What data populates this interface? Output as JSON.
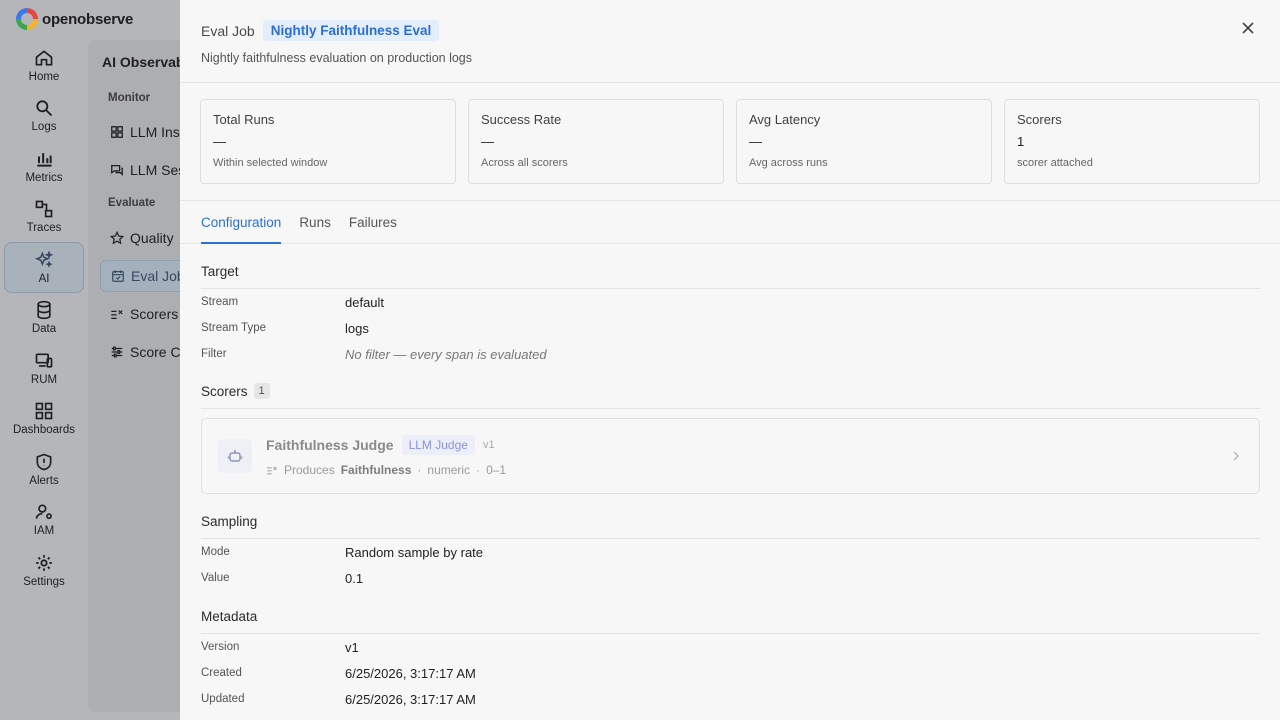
{
  "app": {
    "brand": "openobserve"
  },
  "nav": [
    {
      "label": "Home",
      "icon": "home-icon"
    },
    {
      "label": "Logs",
      "icon": "search-icon"
    },
    {
      "label": "Metrics",
      "icon": "bar-chart-icon"
    },
    {
      "label": "Traces",
      "icon": "traces-icon"
    },
    {
      "label": "AI",
      "icon": "sparkles-icon",
      "active": true
    },
    {
      "label": "Data",
      "icon": "database-icon"
    },
    {
      "label": "RUM",
      "icon": "devices-icon"
    },
    {
      "label": "Dashboards",
      "icon": "dashboard-grid-icon"
    },
    {
      "label": "Alerts",
      "icon": "shield-alert-icon"
    },
    {
      "label": "IAM",
      "icon": "user-gear-icon"
    },
    {
      "label": "Settings",
      "icon": "gear-icon"
    }
  ],
  "subpanel": {
    "title": "AI Observability",
    "groups": {
      "monitor": "Monitor",
      "evaluate": "Evaluate"
    },
    "items": {
      "llm_insights": "LLM Insights",
      "llm_sessions": "LLM Sessions",
      "quality": "Quality",
      "eval_jobs": "Eval Jobs",
      "scorers": "Scorers",
      "score_configs": "Score Configs"
    }
  },
  "drawer": {
    "eyebrow": "Eval Job",
    "name": "Nightly Faithfulness Eval",
    "description": "Nightly faithfulness evaluation on production logs",
    "stats": [
      {
        "title": "Total Runs",
        "value": "—",
        "sub": "Within selected window"
      },
      {
        "title": "Success Rate",
        "value": "—",
        "sub": "Across all scorers"
      },
      {
        "title": "Avg Latency",
        "value": "—",
        "sub": "Avg across runs"
      },
      {
        "title": "Scorers",
        "value": "1",
        "sub": "scorer attached"
      }
    ],
    "tabs": {
      "configuration": "Configuration",
      "runs": "Runs",
      "failures": "Failures"
    },
    "target": {
      "title": "Target",
      "rows": [
        {
          "k": "Stream",
          "v": "default"
        },
        {
          "k": "Stream Type",
          "v": "logs"
        },
        {
          "k": "Filter",
          "v": "No filter — every span is evaluated"
        }
      ]
    },
    "scorers": {
      "title": "Scorers",
      "count": "1",
      "card": {
        "name": "Faithfulness Judge",
        "type": "LLM Judge",
        "version": "v1",
        "produces_label": "Produces",
        "produces_name": "Faithfulness",
        "sep": "·",
        "kind": "numeric",
        "range": "0–1"
      }
    },
    "sampling": {
      "title": "Sampling",
      "rows": [
        {
          "k": "Mode",
          "v": "Random sample by rate"
        },
        {
          "k": "Value",
          "v": "0.1"
        }
      ]
    },
    "metadata": {
      "title": "Metadata",
      "rows": [
        {
          "k": "Version",
          "v": "v1"
        },
        {
          "k": "Created",
          "v": "6/25/2026, 3:17:17 AM"
        },
        {
          "k": "Updated",
          "v": "6/25/2026, 3:17:17 AM"
        }
      ]
    }
  }
}
